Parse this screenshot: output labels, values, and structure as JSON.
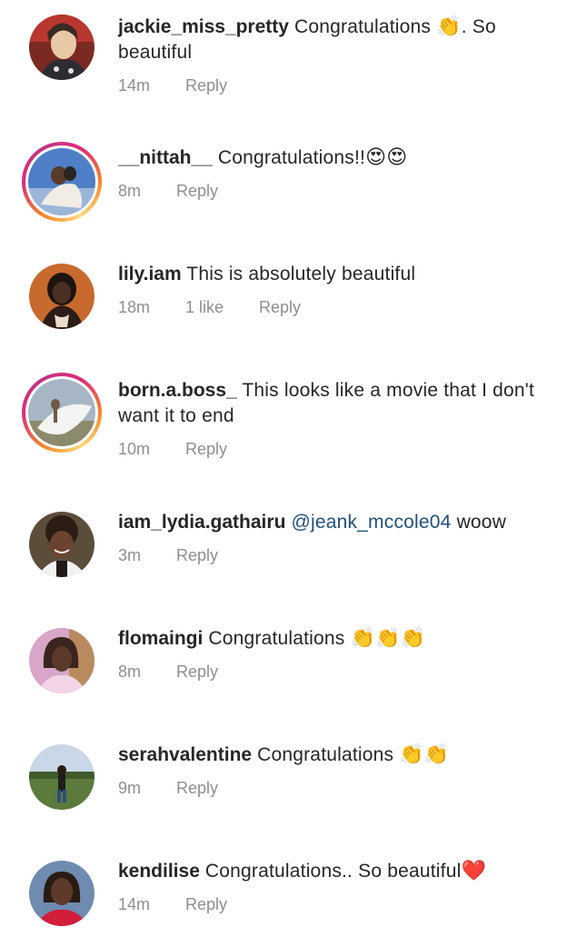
{
  "comments": [
    {
      "username": "jackie_miss_pretty",
      "pre": " Congratulations ",
      "emoji": "👏",
      "post": ". So beautiful",
      "time": "14m",
      "likes": "",
      "reply": "Reply",
      "avatar_colors": [
        "#b8372f",
        "#e8c9a6",
        "#3a2a22"
      ]
    },
    {
      "username": "__nittah__",
      "pre": " Congratulations!!",
      "emoji": "😍😍",
      "post": "",
      "time": "8m",
      "likes": "",
      "reply": "Reply",
      "avatar_colors": [
        "#4f7fc6",
        "#f1ece6",
        "#2a2420"
      ]
    },
    {
      "username": "lily.iam",
      "pre": " This is absolutely beautiful",
      "emoji": "",
      "post": "",
      "time": "18m",
      "likes": "1 like",
      "reply": "Reply",
      "avatar_colors": [
        "#c86a2e",
        "#1c140f",
        "#e9dccf"
      ]
    },
    {
      "username": "born.a.boss_",
      "pre": " This looks like a movie that I don't want it to end",
      "emoji": "",
      "post": "",
      "time": "10m",
      "likes": "",
      "reply": "Reply",
      "avatar_colors": [
        "#a7b6c4",
        "#f4f4f2",
        "#6e5a46"
      ]
    },
    {
      "username": "iam_lydia.gathairu",
      "pre": " ",
      "mention": "@jeank_mccole04",
      "post": " woow",
      "emoji": "",
      "time": "3m",
      "likes": "",
      "reply": "Reply",
      "avatar_colors": [
        "#5a4d3a",
        "#2b1c14",
        "#f2f2f2"
      ]
    },
    {
      "username": "flomaingi",
      "pre": " Congratulations ",
      "emoji": "👏👏👏",
      "post": "",
      "time": "8m",
      "likes": "",
      "reply": "Reply",
      "avatar_colors": [
        "#d7a6c8",
        "#3a2420",
        "#f3d3e6"
      ]
    },
    {
      "username": "serahvalentine",
      "pre": " Congratulations ",
      "emoji": "👏👏",
      "post": "",
      "time": "9m",
      "likes": "",
      "reply": "Reply",
      "avatar_colors": [
        "#c9d7e6",
        "#5c7a3c",
        "#1e1e1e"
      ]
    },
    {
      "username": "kendilise",
      "pre": " Congratulations.. So beautiful",
      "emoji": "❤️",
      "post": "",
      "time": "14m",
      "likes": "",
      "reply": "Reply",
      "avatar_colors": [
        "#6f8bb0",
        "#2a1a14",
        "#d21e3a"
      ]
    }
  ]
}
